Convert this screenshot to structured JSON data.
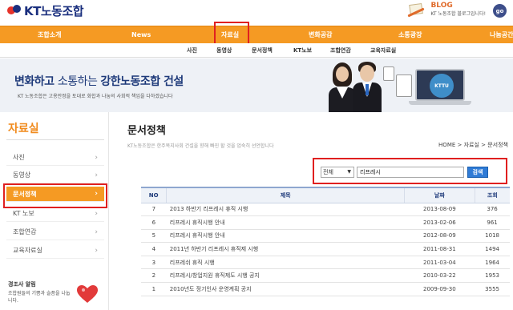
{
  "header": {
    "logo_text": "KT노동조합",
    "blog_title": "BLOG",
    "blog_sub": "KT 노동조합 블로그입니다!",
    "go_label": "go"
  },
  "gnb": {
    "items": [
      {
        "label": "조합소개"
      },
      {
        "label": "News"
      },
      {
        "label": "자료실"
      },
      {
        "label": "변화공감"
      },
      {
        "label": "소통광장"
      },
      {
        "label": "나눔공간"
      }
    ]
  },
  "sub_nav": {
    "items": [
      {
        "label": "사진"
      },
      {
        "label": "동영상"
      },
      {
        "label": "문서정책"
      },
      {
        "label": "KT노보"
      },
      {
        "label": "조합연감"
      },
      {
        "label": "교육자료실"
      }
    ]
  },
  "banner": {
    "title_a": "변화하고 ",
    "title_b": "소통하는 ",
    "title_c": "강한노동조합 건설",
    "subtitle": "KT 노동조합은 고용안정을 토대로 화합과 나눔의 사회적 책임을 다하겠습니다",
    "badge": "KTTU"
  },
  "sidebar": {
    "title": "자료실",
    "items": [
      {
        "label": "사진"
      },
      {
        "label": "동영상"
      },
      {
        "label": "문서정책"
      },
      {
        "label": "KT 노보"
      },
      {
        "label": "조합연감"
      },
      {
        "label": "교육자료실"
      }
    ],
    "notice_title": "경조사 알림",
    "notice_sub": "조합원들의 기쁨과 슬픔을 나눕니다."
  },
  "main": {
    "title": "문서정책",
    "desc": "KT노동조합은 한주복지사회 건설을 향해 빠진 할 것을 엄숙히 선언합니다",
    "breadcrumb": "HOME > 자료실 > 문서정책",
    "search": {
      "select_value": "전체",
      "input_value": "리프레시",
      "button_label": "검색"
    },
    "table": {
      "headers": [
        "NO",
        "제목",
        "날짜",
        "조회"
      ],
      "rows": [
        {
          "no": "7",
          "title": "2013 하반기 리프레시 휴직 시행",
          "date": "2013-08-09",
          "views": "376"
        },
        {
          "no": "6",
          "title": "리프레시 휴직시행 안내",
          "date": "2013-02-06",
          "views": "961"
        },
        {
          "no": "5",
          "title": "리프레시 휴직시행 안내",
          "date": "2012-08-09",
          "views": "1018"
        },
        {
          "no": "4",
          "title": "2011년 하반기 리프레시 휴직제 시행",
          "date": "2011-08-31",
          "views": "1494"
        },
        {
          "no": "3",
          "title": "리프레쉬 휴직 시행",
          "date": "2011-03-04",
          "views": "1964"
        },
        {
          "no": "2",
          "title": "리프레시/창업지원 휴직제도 시행 공지",
          "date": "2010-03-22",
          "views": "1953"
        },
        {
          "no": "1",
          "title": "2010년도 정기인사 운영계획 공지",
          "date": "2009-09-30",
          "views": "3555"
        }
      ]
    }
  },
  "colors": {
    "accent_orange": "#f59a23",
    "highlight_red": "#e02020",
    "brand_navy": "#1a2f7e",
    "search_blue": "#2f7bd6"
  }
}
